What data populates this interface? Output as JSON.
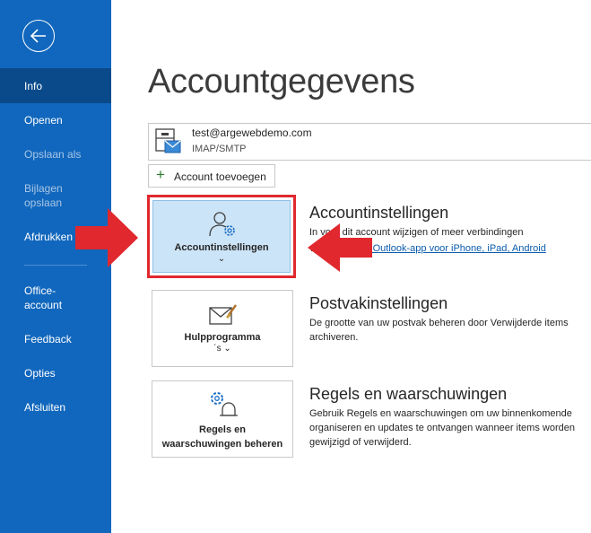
{
  "sidebar": {
    "items": [
      {
        "label": "Info",
        "state": "active"
      },
      {
        "label": "Openen",
        "state": "normal"
      },
      {
        "label": "Opslaan als",
        "state": "disabled"
      },
      {
        "label": "Bijlagen opslaan",
        "state": "disabled"
      },
      {
        "label": "Afdrukken",
        "state": "normal"
      },
      {
        "label": "Office-account",
        "state": "normal"
      },
      {
        "label": "Feedback",
        "state": "normal"
      },
      {
        "label": "Opties",
        "state": "normal"
      },
      {
        "label": "Afsluiten",
        "state": "normal"
      }
    ]
  },
  "page": {
    "title": "Accountgegevens"
  },
  "account": {
    "email": "test@argewebdemo.com",
    "type": "IMAP/SMTP"
  },
  "add_account": {
    "label": "Account toevoegen"
  },
  "sections": {
    "account_settings": {
      "tile_label": "Accountinstellingen",
      "title": "Accountinstellingen",
      "desc": "In      voor dit account wijzigen of meer verbindingen",
      "link": "ad de Outlook-app voor iPhone, iPad, Android"
    },
    "mailbox_settings": {
      "tile_label": "Hulpprogramma",
      "tile_suffix": "´s",
      "title": "Postvakinstellingen",
      "desc1": "De grootte van uw postvak beheren door Verwijderde items",
      "desc2": "archiveren."
    },
    "rules": {
      "tile_label1": "Regels en",
      "tile_label2": "waarschuwingen beheren",
      "title": "Regels en waarschuwingen",
      "desc1": "Gebruik Regels en waarschuwingen om uw binnenkomende",
      "desc2": "organiseren en updates te ontvangen wanneer items worden",
      "desc3": "gewijzigd of verwijderd."
    }
  },
  "colors": {
    "sidebar": "#1167bd",
    "active": "#0a4a8a",
    "highlight": "#e0282e",
    "tile_selected": "#cce4f7"
  },
  "icons": [
    "back-arrow-icon",
    "account-mailbox-icon",
    "plus-icon",
    "person-gear-icon",
    "mailbox-tools-icon",
    "rules-gear-bell-icon",
    "chevron-down-icon",
    "red-arrow-icon"
  ]
}
